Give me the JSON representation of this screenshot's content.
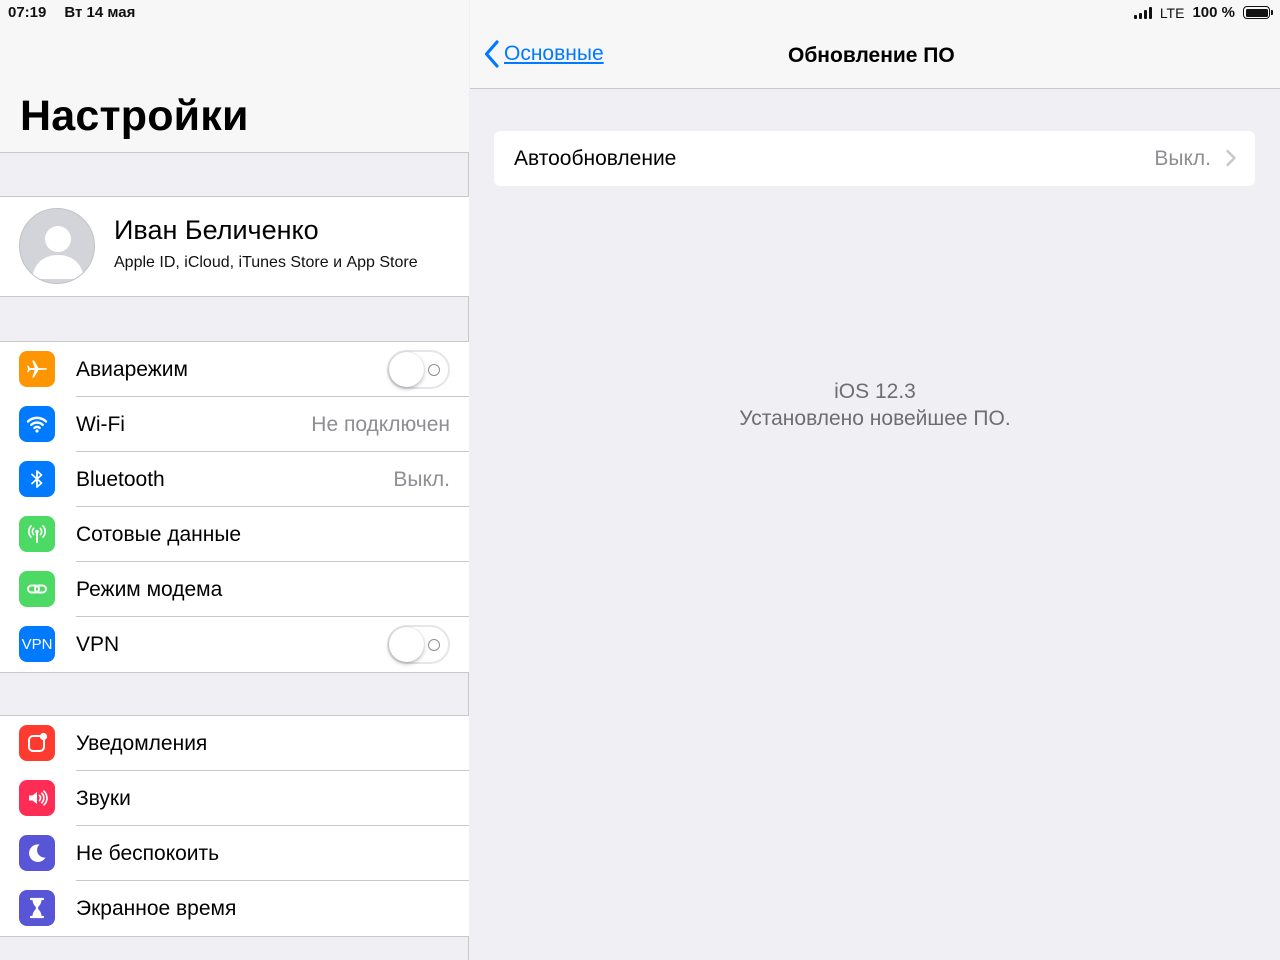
{
  "status_bar": {
    "time": "07:19",
    "date": "Вт 14 мая",
    "network": "LTE",
    "battery": "100 %"
  },
  "sidebar": {
    "title": "Настройки",
    "profile": {
      "name": "Иван Беличенко",
      "subtitle": "Apple ID, iCloud, iTunes Store и App Store"
    },
    "connectivity": [
      {
        "label": "Авиарежим",
        "icon": "airplane-icon",
        "color": "#ff9500",
        "toggle": false
      },
      {
        "label": "Wi-Fi",
        "icon": "wifi-icon",
        "color": "#007aff",
        "value": "Не подключен"
      },
      {
        "label": "Bluetooth",
        "icon": "bluetooth-icon",
        "color": "#007aff",
        "value": "Выкл."
      },
      {
        "label": "Сотовые данные",
        "icon": "cellular-antenna-icon",
        "color": "#4cd964"
      },
      {
        "label": "Режим модема",
        "icon": "personal-hotspot-icon",
        "color": "#4cd964"
      },
      {
        "label": "VPN",
        "icon": "vpn-icon",
        "icon_text": "VPN",
        "color": "#007aff",
        "toggle": false
      }
    ],
    "notifications": [
      {
        "label": "Уведомления",
        "icon": "notifications-icon",
        "color": "#ff3b30"
      },
      {
        "label": "Звуки",
        "icon": "speaker-icon",
        "color": "#ff2d55"
      },
      {
        "label": "Не беспокоить",
        "icon": "moon-icon",
        "color": "#5856d6"
      },
      {
        "label": "Экранное время",
        "icon": "hourglass-icon",
        "color": "#5856d6"
      }
    ]
  },
  "detail": {
    "back_label": "Основные",
    "title": "Обновление ПО",
    "auto_update": {
      "label": "Автообновление",
      "value": "Выкл."
    },
    "ios_version": "iOS 12.3",
    "status_message": "Установлено новейшее ПО."
  },
  "colors": {
    "accent": "#007aff",
    "background": "#efeff4",
    "secondary_text": "#8e8e93"
  }
}
